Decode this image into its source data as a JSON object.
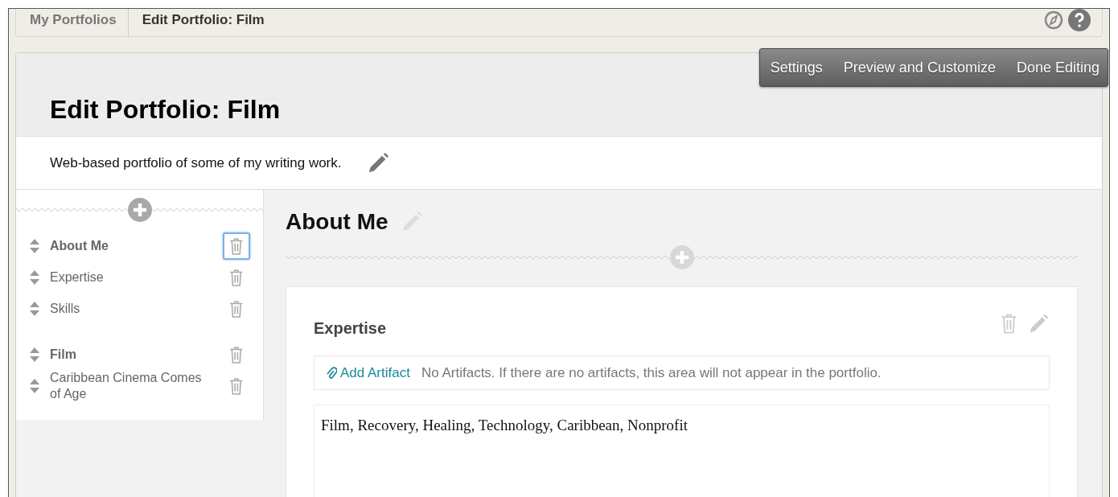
{
  "breadcrumbs": [
    {
      "label": "My Portfolios",
      "selected": false
    },
    {
      "label": "Edit Portfolio: Film",
      "selected": true
    }
  ],
  "toolbar": {
    "buttons": [
      "Settings",
      "Preview and Customize",
      "Done Editing"
    ]
  },
  "page": {
    "title": "Edit Portfolio: Film",
    "description": "Web-based portfolio of some of my writing work."
  },
  "sidebar": {
    "items": [
      {
        "label": "About Me",
        "kind": "section",
        "focused": true
      },
      {
        "label": "Expertise",
        "kind": "page",
        "focused": false
      },
      {
        "label": "Skills",
        "kind": "page",
        "focused": false
      },
      {
        "label": "Film",
        "kind": "section",
        "focused": false
      },
      {
        "label": "Caribbean Cinema Comes of Age",
        "kind": "page",
        "focused": false
      }
    ]
  },
  "content": {
    "title": "About Me",
    "block": {
      "title": "Expertise",
      "add_artifact": "Add Artifact",
      "artifacts_note": "No Artifacts. If there are no artifacts, this area will not appear in the portfolio.",
      "body": "Film, Recovery, Healing, Technology, Caribbean, Nonprofit"
    }
  }
}
